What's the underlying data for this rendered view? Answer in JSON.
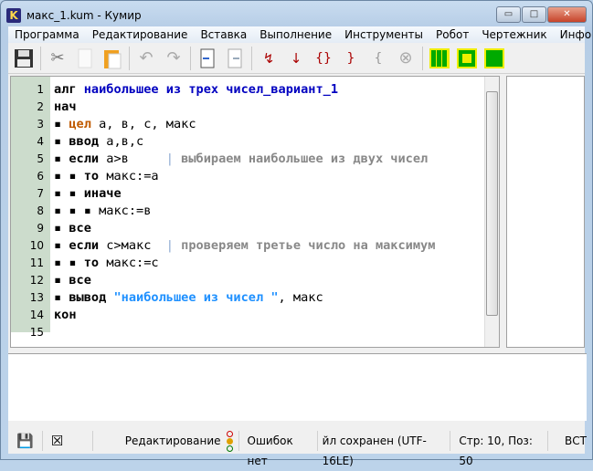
{
  "window": {
    "title": "макс_1.kum - Кумир",
    "logo": "K",
    "minimize": "▭",
    "maximize": "□",
    "close": "✕"
  },
  "menu": [
    "Программа",
    "Редактирование",
    "Вставка",
    "Выполнение",
    "Инструменты",
    "Робот",
    "Чертежник",
    "Инфо"
  ],
  "menu_more": "»",
  "toolbar": [
    "save-icon",
    "cut-icon",
    "copy-icon",
    "paste-icon",
    "undo-icon",
    "redo-icon",
    "indent-icon",
    "unindent-icon",
    "run-to-end-icon",
    "step-into-icon",
    "step-over-icon",
    "step-out-icon",
    "step-back-icon",
    "stop-icon",
    "robot-field-icon",
    "robot-icon",
    "drawer-icon"
  ],
  "editor": {
    "lines": [
      {
        "n": "1",
        "t": [
          [
            "kw",
            "алг "
          ],
          [
            "nm",
            "наибольшее из трех чисел_вариант_1"
          ]
        ]
      },
      {
        "n": "2",
        "t": [
          [
            "kw",
            "нач"
          ]
        ]
      },
      {
        "n": "3",
        "t": [
          [
            "dot",
            "▪ "
          ],
          [
            "ty",
            "цел "
          ],
          [
            "tx",
            "a, в, c, макс"
          ]
        ]
      },
      {
        "n": "4",
        "t": [
          [
            "dot",
            "▪ "
          ],
          [
            "kw",
            "ввод "
          ],
          [
            "tx",
            "a,в,c"
          ]
        ]
      },
      {
        "n": "5",
        "t": [
          [
            "dot",
            "▪ "
          ],
          [
            "kw",
            "если "
          ],
          [
            "tx",
            "a>в     "
          ],
          [
            "bar",
            "| "
          ],
          [
            "cm",
            "выбираем наибольшее из двух чисел"
          ]
        ]
      },
      {
        "n": "6",
        "t": [
          [
            "dot",
            "▪ ▪ "
          ],
          [
            "kw",
            "то "
          ],
          [
            "tx",
            "макс:=a"
          ]
        ]
      },
      {
        "n": "7",
        "t": [
          [
            "dot",
            "▪ ▪ "
          ],
          [
            "kw",
            "иначе"
          ]
        ]
      },
      {
        "n": "8",
        "t": [
          [
            "dot",
            "▪ ▪ ▪ "
          ],
          [
            "tx",
            "макс:=в"
          ]
        ]
      },
      {
        "n": "9",
        "t": [
          [
            "dot",
            "▪ "
          ],
          [
            "kw",
            "все"
          ]
        ]
      },
      {
        "n": "10",
        "t": [
          [
            "dot",
            "▪ "
          ],
          [
            "kw",
            "если "
          ],
          [
            "tx",
            "c>макс  "
          ],
          [
            "bar",
            "| "
          ],
          [
            "cm",
            "проверяем третье число на максимум"
          ]
        ]
      },
      {
        "n": "11",
        "t": [
          [
            "dot",
            "▪ ▪ "
          ],
          [
            "kw",
            "то "
          ],
          [
            "tx",
            "макс:=c"
          ]
        ]
      },
      {
        "n": "12",
        "t": [
          [
            "dot",
            "▪ "
          ],
          [
            "kw",
            "все"
          ]
        ]
      },
      {
        "n": "13",
        "t": [
          [
            "dot",
            "▪ "
          ],
          [
            "kw",
            "вывод "
          ],
          [
            "st",
            "\"наибольшее из чисел \""
          ],
          [
            "tx",
            ", макс"
          ]
        ]
      },
      {
        "n": "14",
        "t": [
          [
            "kw",
            "кон"
          ]
        ]
      },
      {
        "n": "15",
        "t": []
      }
    ]
  },
  "status": {
    "mode": "Редактирование",
    "errors": "Ошибок нет",
    "file": "йл сохранен (UTF-16LE)",
    "position": "Стр: 10, Поз: 50",
    "insert": "ВСТ"
  },
  "colors": {
    "keyword": "#000000",
    "name": "#0000c0",
    "type": "#c05a00",
    "comment": "#888888",
    "string": "#1e90ff",
    "gutter": "#ccdccc"
  }
}
